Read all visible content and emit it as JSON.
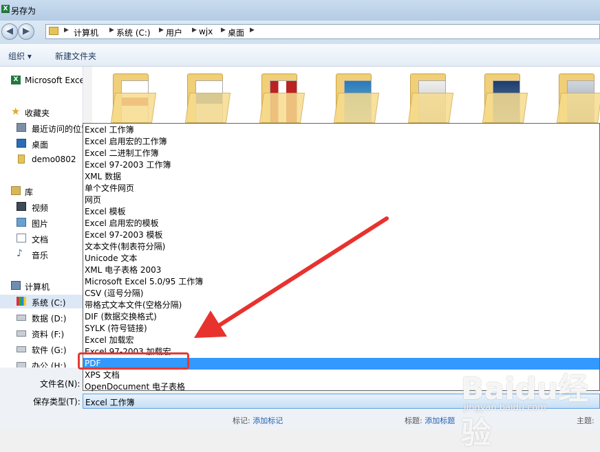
{
  "window": {
    "title": "另存为",
    "app_icon": "excel-icon"
  },
  "nav_buttons": {
    "back": "back-icon",
    "forward": "forward-icon"
  },
  "address": {
    "crumbs": [
      "计算机",
      "系统 (C:)",
      "用户",
      "wjx",
      "桌面"
    ]
  },
  "toolbar": {
    "organize": "组织 ▾",
    "new_folder": "新建文件夹"
  },
  "sidebar": {
    "items": [
      {
        "label": "Microsoft Excel",
        "icon": "excel-icon",
        "header": true
      },
      {
        "label": "收藏夹",
        "icon": "star-icon",
        "header": true
      },
      {
        "label": "最近访问的位置",
        "icon": "recent-icon"
      },
      {
        "label": "桌面",
        "icon": "desktop-icon"
      },
      {
        "label": "demo0802",
        "icon": "folder-icon"
      },
      {
        "label": "库",
        "icon": "library-icon",
        "header": true
      },
      {
        "label": "视频",
        "icon": "video-icon"
      },
      {
        "label": "图片",
        "icon": "picture-icon"
      },
      {
        "label": "文档",
        "icon": "document-icon"
      },
      {
        "label": "音乐",
        "icon": "music-icon"
      },
      {
        "label": "计算机",
        "icon": "computer-icon",
        "header": true
      },
      {
        "label": "系统 (C:)",
        "icon": "drive-icon",
        "selected": true
      },
      {
        "label": "数据 (D:)",
        "icon": "drive-icon"
      },
      {
        "label": "资料 (F:)",
        "icon": "drive-icon"
      },
      {
        "label": "软件 (G:)",
        "icon": "drive-icon"
      },
      {
        "label": "办公 (H:)",
        "icon": "drive-icon"
      }
    ]
  },
  "file_types": {
    "options": [
      "Excel 工作簿",
      "Excel 启用宏的工作簿",
      "Excel 二进制工作簿",
      "Excel 97-2003 工作簿",
      "XML 数据",
      "单个文件网页",
      "网页",
      "Excel 模板",
      "Excel 启用宏的模板",
      "Excel 97-2003 模板",
      "文本文件(制表符分隔)",
      "Unicode 文本",
      "XML 电子表格 2003",
      "Microsoft Excel 5.0/95 工作簿",
      "CSV (逗号分隔)",
      "带格式文本文件(空格分隔)",
      "DIF (数据交换格式)",
      "SYLK (符号链接)",
      "Excel 加载宏",
      "Excel 97-2003 加载宏",
      "PDF",
      "XPS 文档",
      "OpenDocument 电子表格"
    ],
    "selected_index": 20
  },
  "form": {
    "filename_label": "文件名(N):",
    "savetype_label": "保存类型(T):",
    "savetype_value": "Excel 工作簿"
  },
  "metadata": {
    "tags_label": "标记:",
    "tags_value": "添加标记",
    "title_label": "标题:",
    "title_value": "添加标题",
    "subject_label": "主题:"
  },
  "watermark": {
    "logo": "Baidu经验",
    "url": "jingyan.baidu.com"
  },
  "colors": {
    "selection": "#3399ff",
    "highlight": "#e53935",
    "link": "#1f5fb3"
  }
}
